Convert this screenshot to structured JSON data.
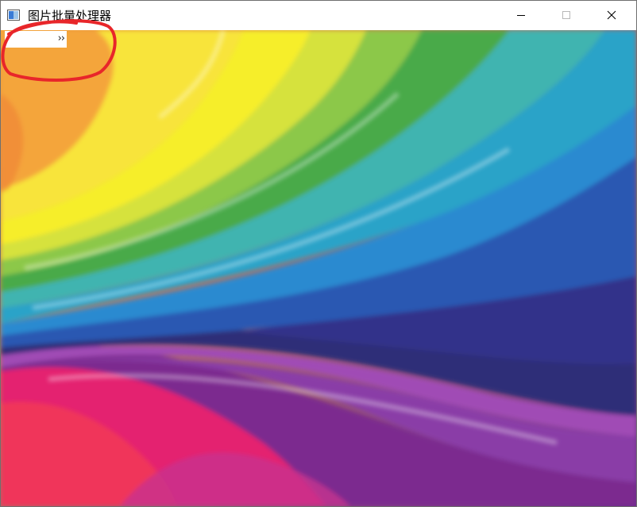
{
  "window": {
    "title": "图片批量处理器",
    "controls": {
      "minimize_icon": "minimize-icon",
      "maximize_icon": "maximize-icon",
      "close_icon": "close-icon"
    }
  },
  "toolbar": {
    "toggle_label": "››",
    "toggle_icon": "chevron-double-right-icon"
  },
  "annotation": {
    "color": "#e8262a"
  },
  "image": {
    "description_icon": "rainbow-swirl-wallpaper",
    "palette": [
      "#f6a431",
      "#f7ef2b",
      "#5ab54a",
      "#2a9fd0",
      "#2b3b90",
      "#7a3aa0",
      "#e3226b"
    ]
  }
}
